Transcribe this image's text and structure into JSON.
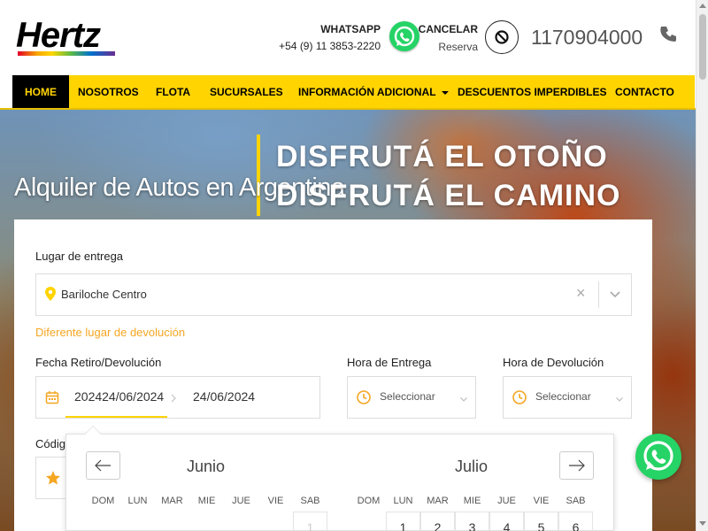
{
  "header": {
    "logo_text": "Hertz",
    "whatsapp_title": "WHATSAPP",
    "whatsapp_number": "+54 (9) 11 3853-2220",
    "cancel_title": "CANCELAR",
    "cancel_sub": "Reserva",
    "phone": "1170904000",
    "icons": [
      "whatsapp-icon",
      "cancel-icon",
      "phone-icon"
    ]
  },
  "nav": {
    "items": [
      {
        "label": "HOME",
        "active": true
      },
      {
        "label": "NOSOTROS"
      },
      {
        "label": "FLOTA"
      },
      {
        "label": "SUCURSALES"
      },
      {
        "label": "INFORMACIÓN ADICIONAL"
      },
      {
        "label": "DESCUENTOS IMPERDIBLES"
      },
      {
        "label": "CONTACTO"
      }
    ]
  },
  "hero": {
    "title": "Alquiler de Autos en Argentina",
    "promo_line1": "DISFRUTÁ EL OTOÑO",
    "promo_line2": "DISFRUTÁ EL CAMINO"
  },
  "form": {
    "pickup_label": "Lugar de entrega",
    "pickup_value": "Bariloche Centro",
    "clear_symbol": "×",
    "different_return_link": "Diferente lugar de devolución",
    "dates_label": "Fecha Retiro/Devolución",
    "date_start": "202424/06/2024",
    "date_end": "24/06/2024",
    "pickup_time_label": "Hora de Entrega",
    "pickup_time_placeholder": "Seleccionar",
    "return_time_label": "Hora de Devolución",
    "return_time_placeholder": "Seleccionar",
    "code_label": "Códig"
  },
  "datepicker": {
    "month_left": "Junio",
    "month_right": "Julio",
    "prev_symbol": "←",
    "next_symbol": "→",
    "weekdays": [
      "DOM",
      "LUN",
      "MAR",
      "MIE",
      "JUE",
      "VIE",
      "SAB"
    ],
    "june_first_row": [
      "",
      "",
      "",
      "",
      "",
      "",
      "1"
    ],
    "july_first_row": [
      "",
      "1",
      "2",
      "3",
      "4",
      "5",
      "6"
    ]
  },
  "colors": {
    "brand_yellow": "#ffd400",
    "whatsapp_green": "#25d366",
    "link_orange": "#f5a623"
  }
}
